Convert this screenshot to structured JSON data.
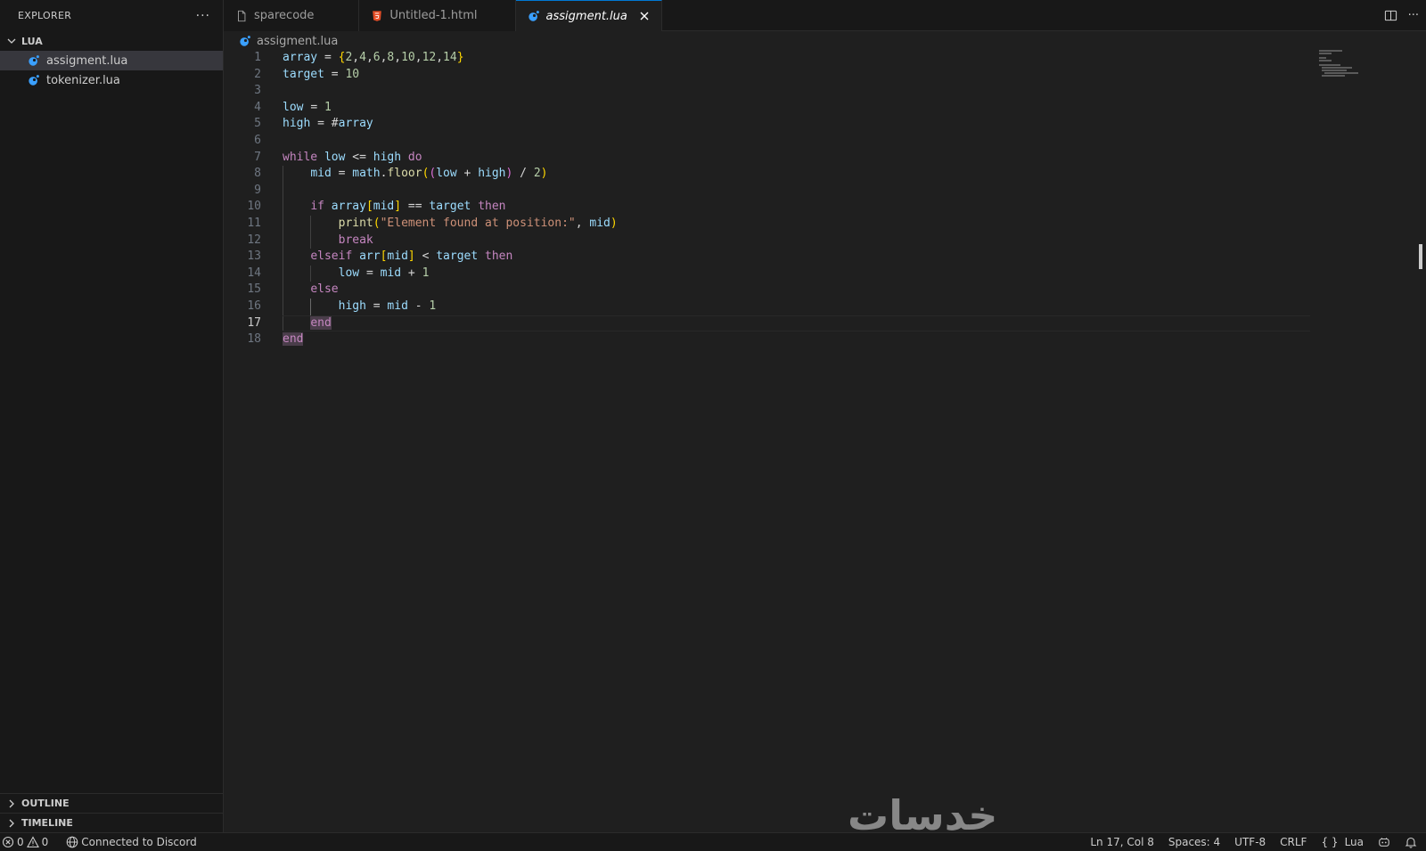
{
  "sidebar": {
    "title": "EXPLORER",
    "more": "···",
    "folder": "LUA",
    "files": [
      {
        "name": "assigment.lua",
        "active": true
      },
      {
        "name": "tokenizer.lua",
        "active": false
      }
    ],
    "outline": "OUTLINE",
    "timeline": "TIMELINE"
  },
  "tabs": [
    {
      "label": "sparecode",
      "icon": "file-icon"
    },
    {
      "label": "Untitled-1.html",
      "icon": "html-icon"
    },
    {
      "label": "assigment.lua",
      "icon": "lua-icon",
      "active": true
    }
  ],
  "tab_actions": {
    "more": "···"
  },
  "breadcrumb": "assigment.lua",
  "editor": {
    "current_line": 17,
    "lines": [
      {
        "n": "1"
      },
      {
        "n": "2"
      },
      {
        "n": "3"
      },
      {
        "n": "4"
      },
      {
        "n": "5"
      },
      {
        "n": "6"
      },
      {
        "n": "7"
      },
      {
        "n": "8"
      },
      {
        "n": "9"
      },
      {
        "n": "10"
      },
      {
        "n": "11"
      },
      {
        "n": "12"
      },
      {
        "n": "13"
      },
      {
        "n": "14"
      },
      {
        "n": "15"
      },
      {
        "n": "16"
      },
      {
        "n": "17"
      },
      {
        "n": "18"
      }
    ]
  },
  "watermark": "خدسات",
  "status": {
    "errors": "0",
    "warnings": "0",
    "discord": "Connected to Discord",
    "position": "Ln 17, Col 8",
    "spaces": "Spaces: 4",
    "encoding": "UTF-8",
    "eol": "CRLF",
    "language_braces": "{ }",
    "language": "Lua"
  },
  "colors": {
    "accent": "#0078d4",
    "lua": "#3aa0ff",
    "html": "#e44d26"
  }
}
